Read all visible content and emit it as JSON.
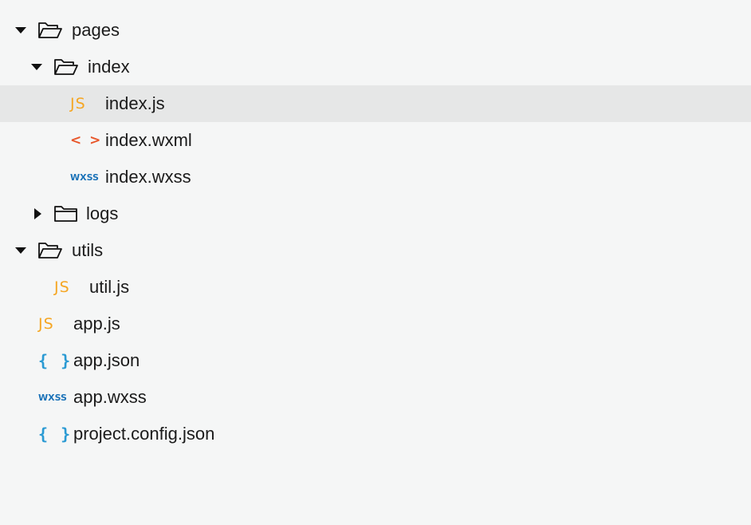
{
  "tree": {
    "pages": {
      "label": "pages",
      "expanded": true
    },
    "index": {
      "label": "index",
      "expanded": true
    },
    "index_js": {
      "label": "index.js",
      "icon_text": "JS",
      "selected": true
    },
    "index_wxml": {
      "label": "index.wxml",
      "icon_text": "< >"
    },
    "index_wxss": {
      "label": "index.wxss",
      "icon_text": "WXSS"
    },
    "logs": {
      "label": "logs",
      "expanded": false
    },
    "utils": {
      "label": "utils",
      "expanded": true
    },
    "util_js": {
      "label": "util.js",
      "icon_text": "JS"
    },
    "app_js": {
      "label": "app.js",
      "icon_text": "JS"
    },
    "app_json": {
      "label": "app.json",
      "icon_text": "{ }"
    },
    "app_wxss": {
      "label": "app.wxss",
      "icon_text": "WXSS"
    },
    "project_config_json": {
      "label": "project.config.json",
      "icon_text": "{ }"
    }
  },
  "colors": {
    "js": "#f5a623",
    "wxml": "#e8562a",
    "wxss": "#1a72b8",
    "json": "#2a9ad3",
    "selected_row": "#e6e7e7",
    "background": "#f5f6f6"
  }
}
